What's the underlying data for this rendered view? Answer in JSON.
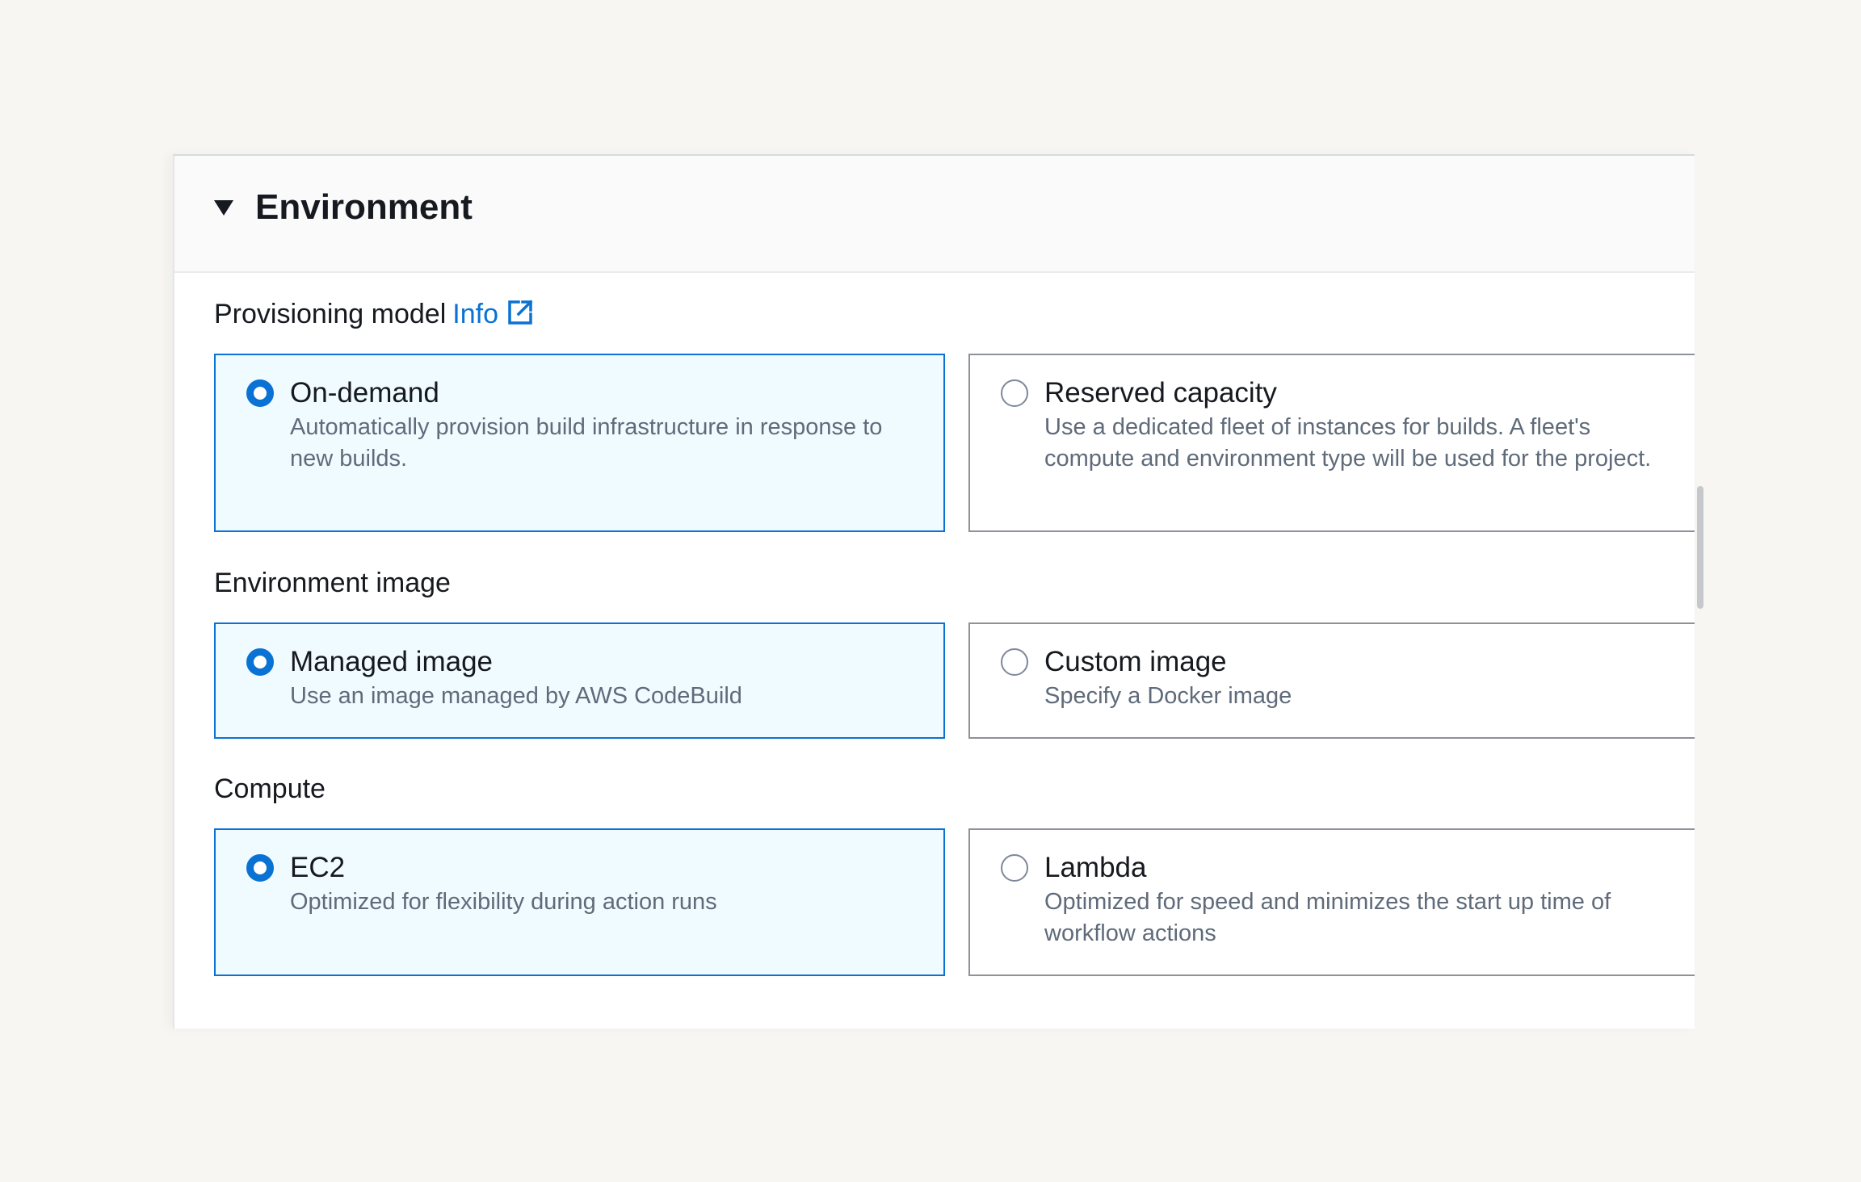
{
  "panel": {
    "title": "Environment",
    "caret_icon": "caret-down-icon"
  },
  "provisioning_model": {
    "label": "Provisioning model",
    "info_link": "Info",
    "external_icon": "external-link-icon",
    "options": [
      {
        "title": "On-demand",
        "description": "Automatically provision build infrastructure in response to new builds.",
        "selected": true
      },
      {
        "title": "Reserved capacity",
        "description": "Use a dedicated fleet of instances for builds. A fleet's compute and environment type will be used for the project.",
        "selected": false
      }
    ]
  },
  "environment_image": {
    "label": "Environment image",
    "options": [
      {
        "title": "Managed image",
        "description": "Use an image managed by AWS CodeBuild",
        "selected": true
      },
      {
        "title": "Custom image",
        "description": "Specify a Docker image",
        "selected": false
      }
    ]
  },
  "compute": {
    "label": "Compute",
    "options": [
      {
        "title": "EC2",
        "description": "Optimized for flexibility during action runs",
        "selected": true
      },
      {
        "title": "Lambda",
        "description": "Optimized for speed and minimizes the start up time of workflow actions",
        "selected": false
      }
    ]
  },
  "colors": {
    "accent": "#0972d3",
    "selected_bg": "#f0fbff",
    "text_primary": "#16191f",
    "text_secondary": "#5f6b7a",
    "border_unselected": "#8d9199"
  }
}
